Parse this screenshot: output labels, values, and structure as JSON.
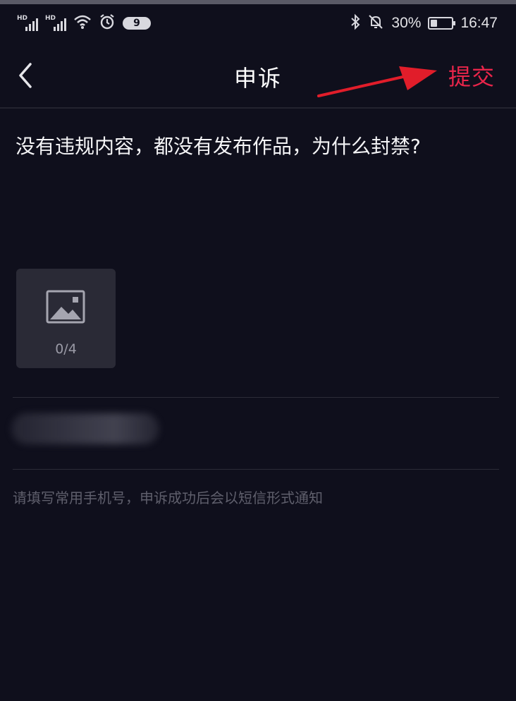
{
  "status_bar": {
    "signal_label_1": "HD",
    "signal_label_2": "HD",
    "notification_badge": "9",
    "battery_percent": "30%",
    "time": "16:47",
    "icons": [
      "signal-icon",
      "wifi-icon",
      "alarm-icon",
      "bluetooth-icon",
      "mute-icon",
      "battery-icon"
    ]
  },
  "nav": {
    "title": "申诉",
    "submit_label": "提交",
    "back_icon": "chevron-left-icon"
  },
  "form": {
    "appeal_text": "没有违规内容，都没有发布作品，为什么封禁?",
    "upload": {
      "icon": "image-icon",
      "count": "0/4"
    },
    "phone_hint": "请填写常用手机号，申诉成功后会以短信形式通知"
  },
  "colors": {
    "background": "#0f0f1c",
    "accent": "#e8254a",
    "annotation_arrow": "#e11d2a",
    "tile": "#2a2a36"
  }
}
